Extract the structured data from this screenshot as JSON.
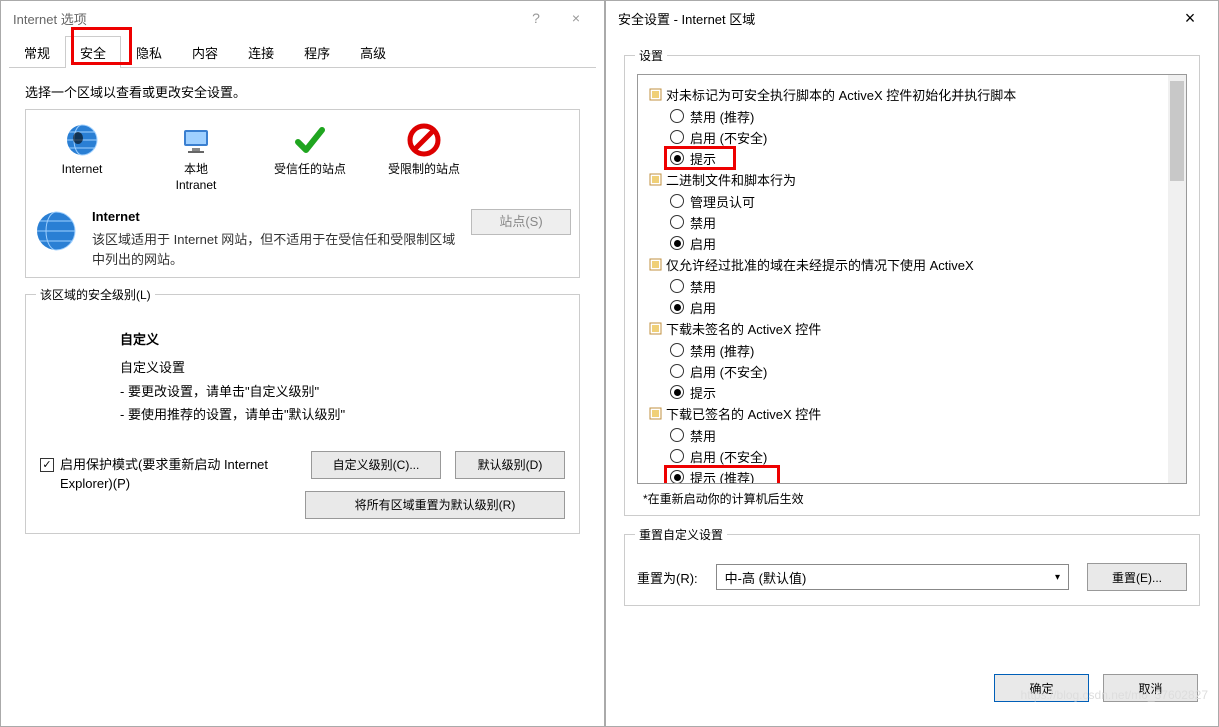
{
  "left": {
    "title": "Internet 选项",
    "help": "?",
    "close": "×",
    "tabs": [
      "常规",
      "安全",
      "隐私",
      "内容",
      "连接",
      "程序",
      "高级"
    ],
    "active_tab": "安全",
    "zone_instruction": "选择一个区域以查看或更改安全设置。",
    "zones": [
      {
        "label": "Internet"
      },
      {
        "label": "本地\nIntranet"
      },
      {
        "label": "受信任的站点"
      },
      {
        "label": "受限制的站点"
      }
    ],
    "zone_desc": {
      "heading": "Internet",
      "body": "该区域适用于 Internet 网站，但不适用于在受信任和受限制区域中列出的网站。",
      "sites_btn": "站点(S)"
    },
    "level_legend": "该区域的安全级别(L)",
    "custom": {
      "heading": "自定义",
      "line1": "自定义设置",
      "line2": "- 要更改设置，请单击\"自定义级别\"",
      "line3": "- 要使用推荐的设置，请单击\"默认级别\""
    },
    "protect_cb": "启用保护模式(要求重新启动 Internet Explorer)(P)",
    "btn_custom": "自定义级别(C)...",
    "btn_default": "默认级别(D)",
    "btn_reset_all": "将所有区域重置为默认级别(R)"
  },
  "right": {
    "title": "安全设置 - Internet 区域",
    "close": "×",
    "settings_legend": "设置",
    "groups": [
      {
        "label": "对未标记为可安全执行脚本的 ActiveX 控件初始化并执行脚本",
        "options": [
          {
            "t": "禁用 (推荐)",
            "c": false
          },
          {
            "t": "启用 (不安全)",
            "c": false
          },
          {
            "t": "提示",
            "c": true
          }
        ]
      },
      {
        "label": "二进制文件和脚本行为",
        "options": [
          {
            "t": "管理员认可",
            "c": false
          },
          {
            "t": "禁用",
            "c": false
          },
          {
            "t": "启用",
            "c": true
          }
        ]
      },
      {
        "label": "仅允许经过批准的域在未经提示的情况下使用 ActiveX",
        "options": [
          {
            "t": "禁用",
            "c": false
          },
          {
            "t": "启用",
            "c": true
          }
        ]
      },
      {
        "label": "下载未签名的 ActiveX 控件",
        "options": [
          {
            "t": "禁用 (推荐)",
            "c": false
          },
          {
            "t": "启用 (不安全)",
            "c": false
          },
          {
            "t": "提示",
            "c": true
          }
        ]
      },
      {
        "label": "下载已签名的 ActiveX 控件",
        "options": [
          {
            "t": "禁用",
            "c": false
          },
          {
            "t": "启用 (不安全)",
            "c": false
          },
          {
            "t": "提示 (推荐)",
            "c": true
          }
        ]
      }
    ],
    "note": "*在重新启动你的计算机后生效",
    "reset_legend": "重置自定义设置",
    "reset_label": "重置为(R):",
    "reset_select": "中-高 (默认值)",
    "btn_reset": "重置(E)...",
    "btn_ok": "确定",
    "btn_cancel": "取消"
  },
  "watermark": "https://blog.csdn.net/m0_37602827"
}
